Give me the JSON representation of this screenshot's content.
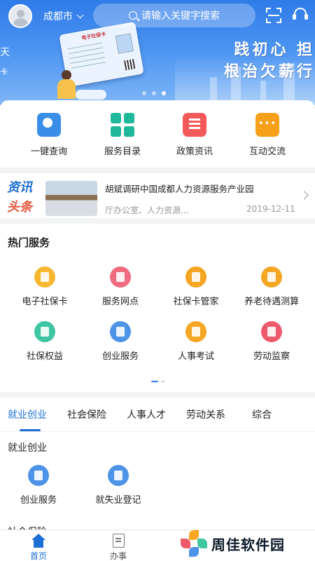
{
  "header": {
    "city": "成都市",
    "search_placeholder": "请输入关键字搜索"
  },
  "banner": {
    "slogan_line1": "践初心  担",
    "slogan_line2": "根治欠薪行",
    "left_edge_top": "天",
    "left_edge_bottom": "卡",
    "card_title": "电子社保卡",
    "slide_count": 3,
    "active_slide": 3
  },
  "quick_actions": [
    {
      "label": "一键查询",
      "icon": "search-icon",
      "color": "#3a8ee8"
    },
    {
      "label": "服务目录",
      "icon": "grid-icon",
      "color": "#1fb89a"
    },
    {
      "label": "政策资讯",
      "icon": "book-icon",
      "color": "#f25a5a"
    },
    {
      "label": "互动交流",
      "icon": "chat-bubble-icon",
      "color": "#f7a11a"
    }
  ],
  "news": {
    "tag_line1": "资讯",
    "tag_line2": "头条",
    "title": "胡斌调研中国成都人力资源服务产业园",
    "source": "厅办公室、人力资源...",
    "date": "2019-12-11"
  },
  "hot_services": {
    "title": "热门服务",
    "items": [
      {
        "label": "电子社保卡",
        "icon": "id-card-icon"
      },
      {
        "label": "服务网点",
        "icon": "location-icon"
      },
      {
        "label": "社保卡管家",
        "icon": "card-manager-icon"
      },
      {
        "label": "养老待遇测算",
        "icon": "calculator-icon"
      },
      {
        "label": "社保权益",
        "icon": "shield-icon"
      },
      {
        "label": "创业服务",
        "icon": "money-bag-icon"
      },
      {
        "label": "人事考试",
        "icon": "exam-paper-icon"
      },
      {
        "label": "劳动监察",
        "icon": "inspector-icon"
      }
    ]
  },
  "category_tabs": {
    "tabs": [
      "就业创业",
      "社会保险",
      "人事人才",
      "劳动关系",
      "综合"
    ],
    "active": "就业创业",
    "section1_title": "就业创业",
    "section1_items": [
      {
        "label": "创业服务",
        "icon": "money-bag-icon"
      },
      {
        "label": "就失业登记",
        "icon": "briefcase-icon"
      }
    ],
    "section2_title": "社会保险"
  },
  "bottom_nav": {
    "items": [
      {
        "label": "首页",
        "icon": "home-icon",
        "active": true
      },
      {
        "label": "办事",
        "icon": "document-icon",
        "active": false
      }
    ]
  },
  "watermark": {
    "text": "周佳软件园"
  },
  "colors": {
    "primary": "#1d6fd6",
    "banner_blue": "#2f7be8"
  }
}
